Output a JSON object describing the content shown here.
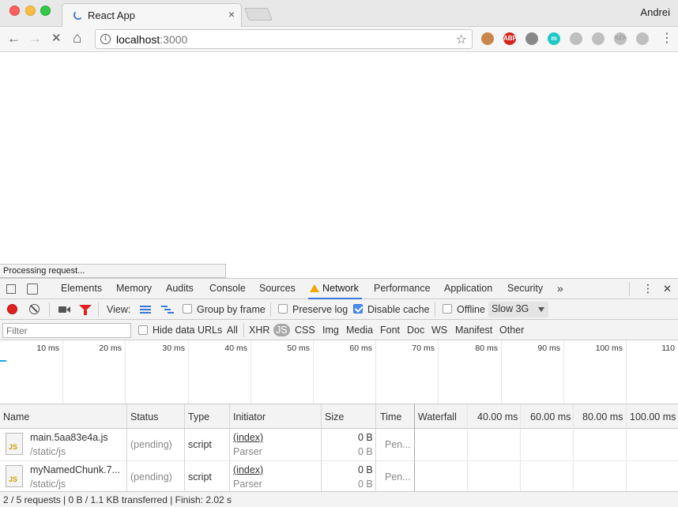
{
  "window": {
    "tab_title": "React App",
    "tab_close": "×",
    "profile_name": "Andrei"
  },
  "toolbar": {
    "back": "←",
    "forward": "→",
    "stop": "✕",
    "home": "⌂",
    "url_host": "localhost",
    "url_port": ":3000",
    "bookmark_star": "☆",
    "extensions": [
      {
        "icon": "cookie-icon",
        "label": "",
        "color": "#c8864a"
      },
      {
        "icon": "adblock-plus-icon",
        "label": "ABP",
        "color": "#d6251f"
      },
      {
        "icon": "jar-icon",
        "label": "",
        "color": "#888888"
      },
      {
        "icon": "m-extension-icon",
        "label": "m",
        "color": "#20c7c7"
      },
      {
        "icon": "leaf-icon",
        "label": "",
        "color": "#bfbfbf"
      },
      {
        "icon": "grid-extension-icon",
        "label": "",
        "color": "#bfbfbf"
      },
      {
        "icon": "code-icon",
        "label": "</>",
        "color": "#bfbfbf"
      },
      {
        "icon": "react-devtools-icon",
        "label": "",
        "color": "#bfbfbf"
      }
    ],
    "menu": "⋮"
  },
  "page": {
    "status_bubble": "Processing request..."
  },
  "devtools": {
    "tabs": [
      "Elements",
      "Memory",
      "Audits",
      "Console",
      "Sources",
      "Network",
      "Performance",
      "Application",
      "Security"
    ],
    "active_tab": "Network",
    "more_tabs": "»",
    "menu": "⋮",
    "close": "✕",
    "network_toolbar": {
      "view_label": "View:",
      "group_by_frame": "Group by frame",
      "preserve_log": "Preserve log",
      "disable_cache": "Disable cache",
      "offline": "Offline",
      "throttling": "Slow 3G"
    },
    "filter": {
      "placeholder": "Filter",
      "hide_data_urls": "Hide data URLs",
      "types": [
        "All",
        "XHR",
        "JS",
        "CSS",
        "Img",
        "Media",
        "Font",
        "Doc",
        "WS",
        "Manifest",
        "Other"
      ],
      "active_type": "JS"
    },
    "overview_ticks": [
      "10 ms",
      "20 ms",
      "30 ms",
      "40 ms",
      "50 ms",
      "60 ms",
      "70 ms",
      "80 ms",
      "90 ms",
      "100 ms",
      "110"
    ],
    "columns": {
      "name": "Name",
      "status": "Status",
      "type": "Type",
      "initiator": "Initiator",
      "size": "Size",
      "time": "Time",
      "waterfall": "Waterfall",
      "wf_ticks": [
        "40.00 ms",
        "60.00 ms",
        "80.00 ms",
        "100.00 ms"
      ]
    },
    "rows": [
      {
        "name": "main.5aa83e4a.js",
        "path": "/static/js",
        "status": "(pending)",
        "type": "script",
        "initiator": "(index)",
        "initiator_sub": "Parser",
        "size": "0 B",
        "size_sub": "0 B",
        "time": "Pen..."
      },
      {
        "name": "myNamedChunk.7...",
        "path": "/static/js",
        "status": "(pending)",
        "type": "script",
        "initiator": "(index)",
        "initiator_sub": "Parser",
        "size": "0 B",
        "size_sub": "0 B",
        "time": "Pen..."
      }
    ],
    "summary": "2 / 5 requests | 0 B / 1.1 KB transferred | Finish: 2.02 s"
  }
}
